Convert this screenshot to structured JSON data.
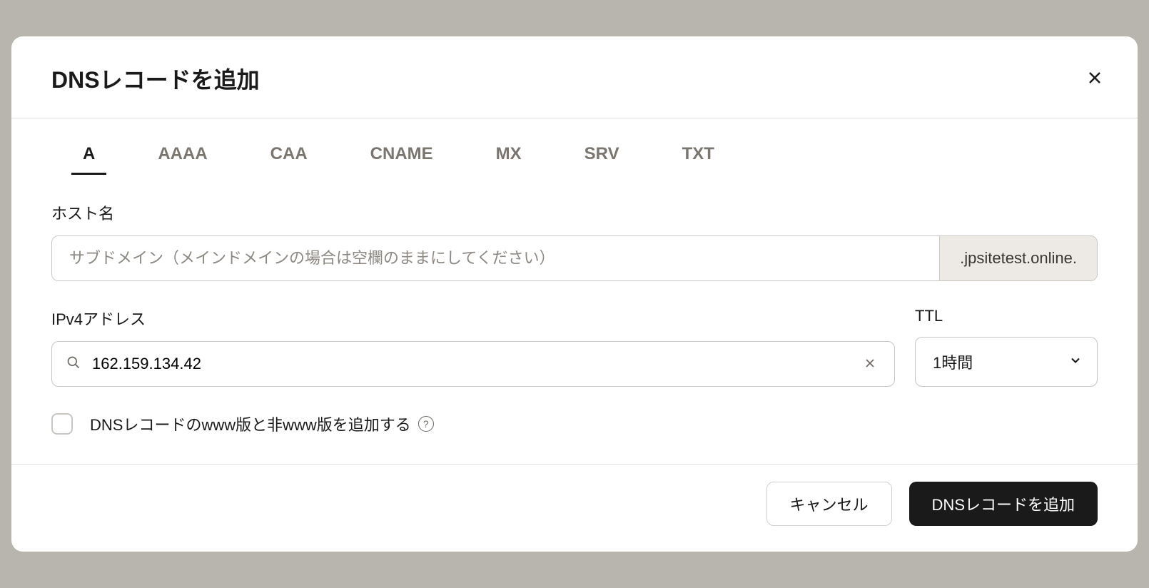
{
  "modal": {
    "title": "DNSレコードを追加"
  },
  "tabs": {
    "items": [
      {
        "label": "A",
        "active": true
      },
      {
        "label": "AAAA",
        "active": false
      },
      {
        "label": "CAA",
        "active": false
      },
      {
        "label": "CNAME",
        "active": false
      },
      {
        "label": "MX",
        "active": false
      },
      {
        "label": "SRV",
        "active": false
      },
      {
        "label": "TXT",
        "active": false
      }
    ]
  },
  "fields": {
    "hostname": {
      "label": "ホスト名",
      "placeholder": "サブドメイン（メインドメインの場合は空欄のままにしてください）",
      "suffix": ".jpsitetest.online.",
      "value": ""
    },
    "ipv4": {
      "label": "IPv4アドレス",
      "value": "162.159.134.42"
    },
    "ttl": {
      "label": "TTL",
      "value": "1時間"
    },
    "checkbox": {
      "label": "DNSレコードのwww版と非www版を追加する",
      "checked": false
    }
  },
  "footer": {
    "cancel": "キャンセル",
    "submit": "DNSレコードを追加"
  }
}
